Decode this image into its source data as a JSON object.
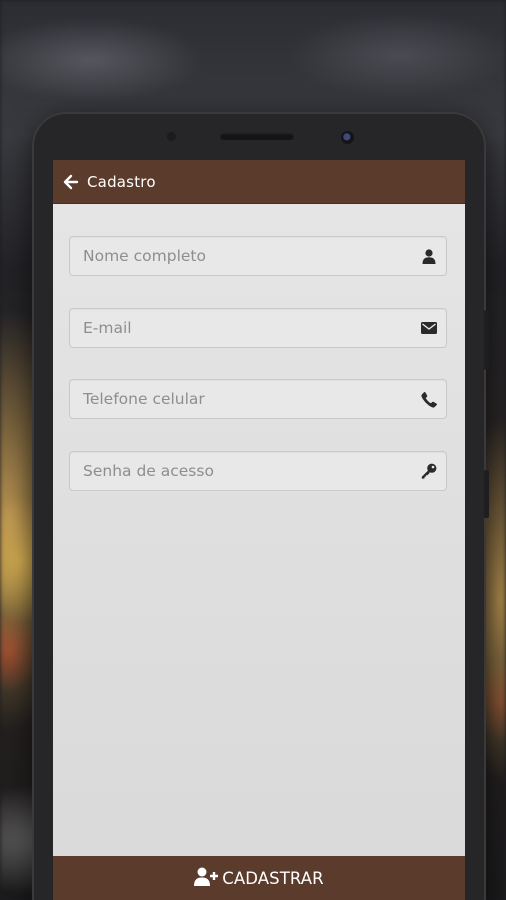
{
  "appbar": {
    "title": "Cadastro",
    "back_icon": "arrow-left-icon"
  },
  "form": {
    "fields": [
      {
        "placeholder": "Nome completo",
        "value": "",
        "icon": "user-icon"
      },
      {
        "placeholder": "E-mail",
        "value": "",
        "icon": "envelope-icon"
      },
      {
        "placeholder": "Telefone celular",
        "value": "",
        "icon": "phone-icon"
      },
      {
        "placeholder": "Senha de acesso",
        "value": "",
        "icon": "key-icon"
      }
    ]
  },
  "submit": {
    "label": "CADASTRAR",
    "icon": "user-plus-icon"
  },
  "colors": {
    "brand": "#5b3b2b",
    "screen_bg": "#e3e3e3",
    "field_bg": "#e8e8e8",
    "field_border": "#c9c9c9",
    "icon": "#2a2a2a"
  }
}
